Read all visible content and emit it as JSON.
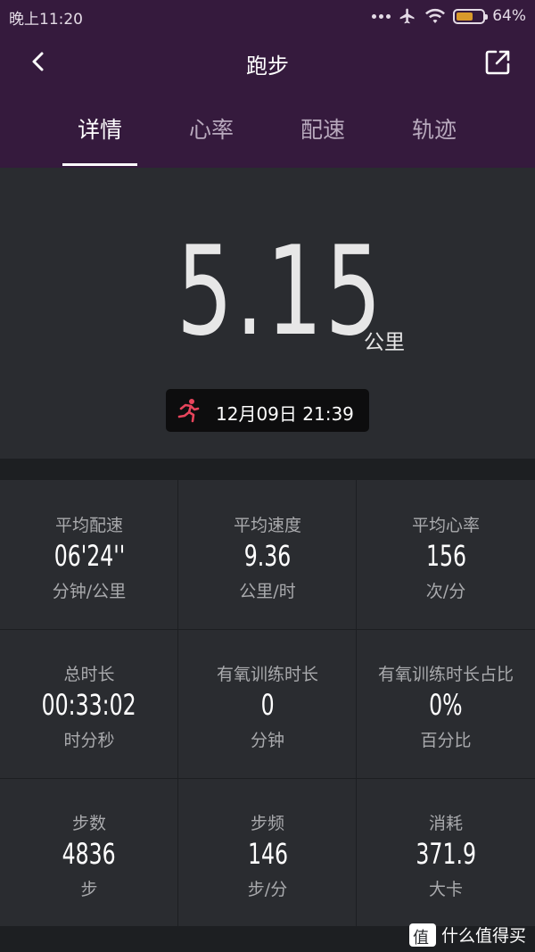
{
  "status_bar": {
    "time": "晚上11:20",
    "battery": "64%",
    "battery_level": 0.64,
    "icons": [
      "more-dots-icon",
      "airplane-icon",
      "wifi-icon",
      "battery-icon"
    ]
  },
  "nav": {
    "title": "跑步",
    "back_icon": "chevron-left-icon",
    "share_icon": "share-icon"
  },
  "tabs": [
    {
      "label": "详情",
      "active": true
    },
    {
      "label": "心率",
      "active": false
    },
    {
      "label": "配速",
      "active": false
    },
    {
      "label": "轨迹",
      "active": false
    }
  ],
  "summary": {
    "distance": "5.15",
    "distance_unit": "公里",
    "activity_icon": "running-icon",
    "date": "12月09日 21:39"
  },
  "stats": [
    {
      "label": "平均配速",
      "value": "06'24''",
      "unit": "分钟/公里"
    },
    {
      "label": "平均速度",
      "value": "9.36",
      "unit": "公里/时"
    },
    {
      "label": "平均心率",
      "value": "156",
      "unit": "次/分"
    },
    {
      "label": "总时长",
      "value": "00:33:02",
      "unit": "时分秒"
    },
    {
      "label": "有氧训练时长",
      "value": "0",
      "unit": "分钟"
    },
    {
      "label": "有氧训练时长占比",
      "value": "0%",
      "unit": "百分比"
    },
    {
      "label": "步数",
      "value": "4836",
      "unit": "步"
    },
    {
      "label": "步频",
      "value": "146",
      "unit": "步/分"
    },
    {
      "label": "消耗",
      "value": "371.9",
      "unit": "大卡"
    }
  ],
  "watermark": {
    "text": "什么值得买"
  },
  "colors": {
    "header_bg": "#351a3d",
    "panel_bg": "#2a2c30",
    "page_bg": "#1d1f22",
    "accent_run": "#e8455c",
    "battery_fill": "#d99a2b"
  }
}
